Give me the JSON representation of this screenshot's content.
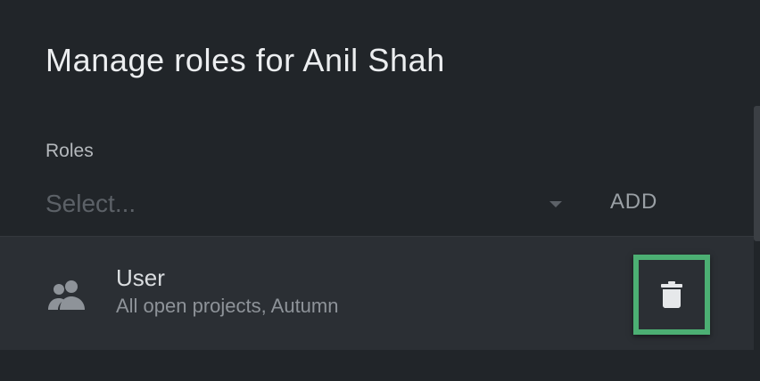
{
  "dialog": {
    "title": "Manage roles for Anil Shah"
  },
  "roles_field": {
    "label": "Roles",
    "placeholder": "Select...",
    "add_label": "ADD"
  },
  "assigned_roles": [
    {
      "name": "User",
      "scope": "All open projects, Autumn",
      "icon": "people-icon"
    }
  ],
  "icons": {
    "delete": "trash-icon",
    "dropdown": "chevron-down-icon"
  },
  "colors": {
    "background": "#212529",
    "row_background": "#2b2f34",
    "highlight": "#4caf73"
  }
}
